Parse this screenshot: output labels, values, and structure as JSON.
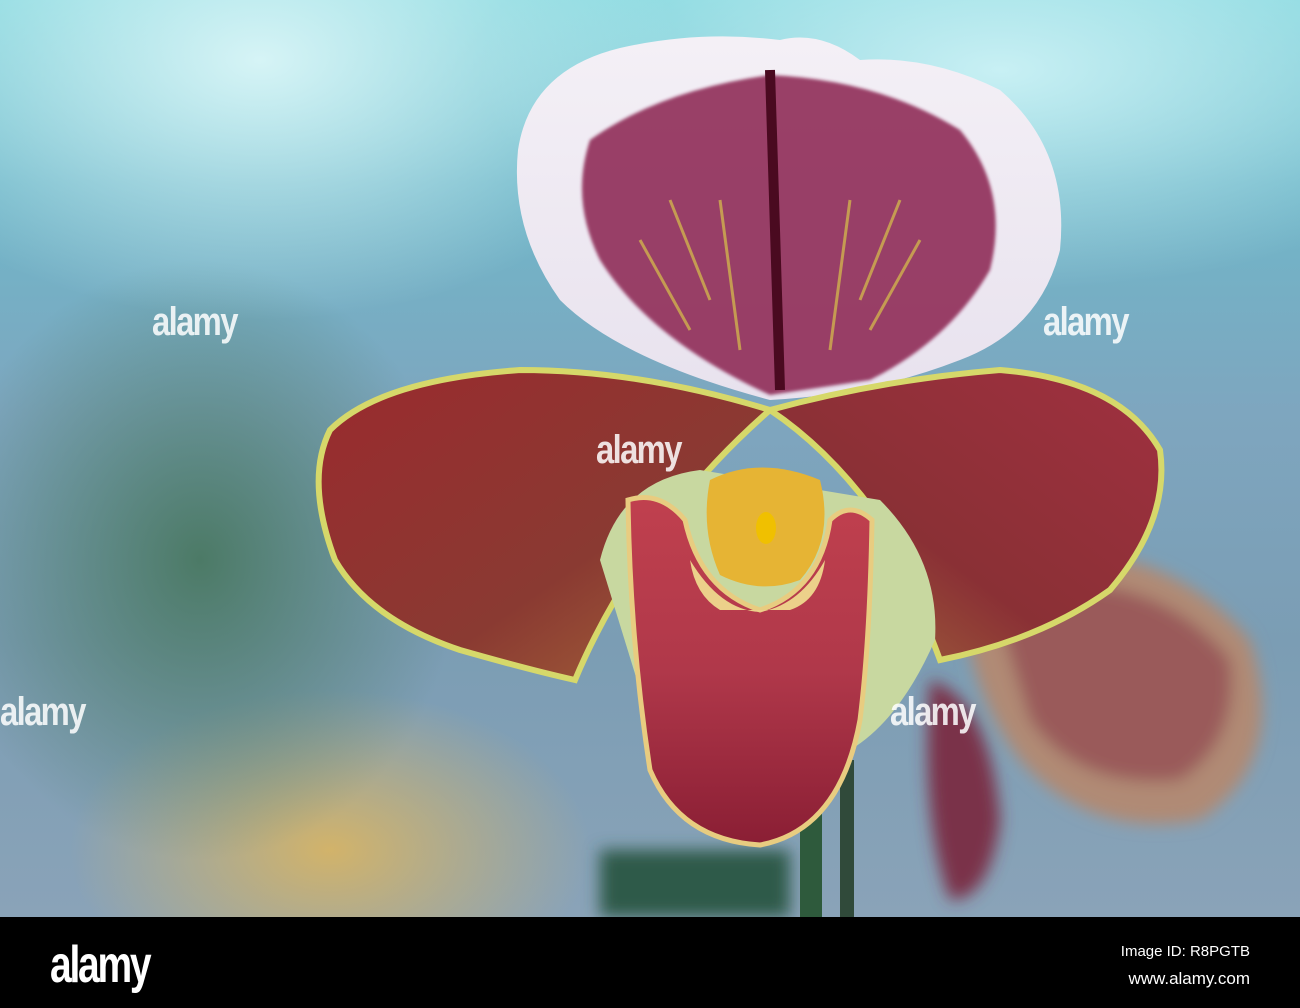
{
  "watermark": {
    "text": "alamy"
  },
  "footer": {
    "logo": "alamy",
    "image_id": "Image ID: R8PGTB",
    "url": "www.alamy.com"
  }
}
